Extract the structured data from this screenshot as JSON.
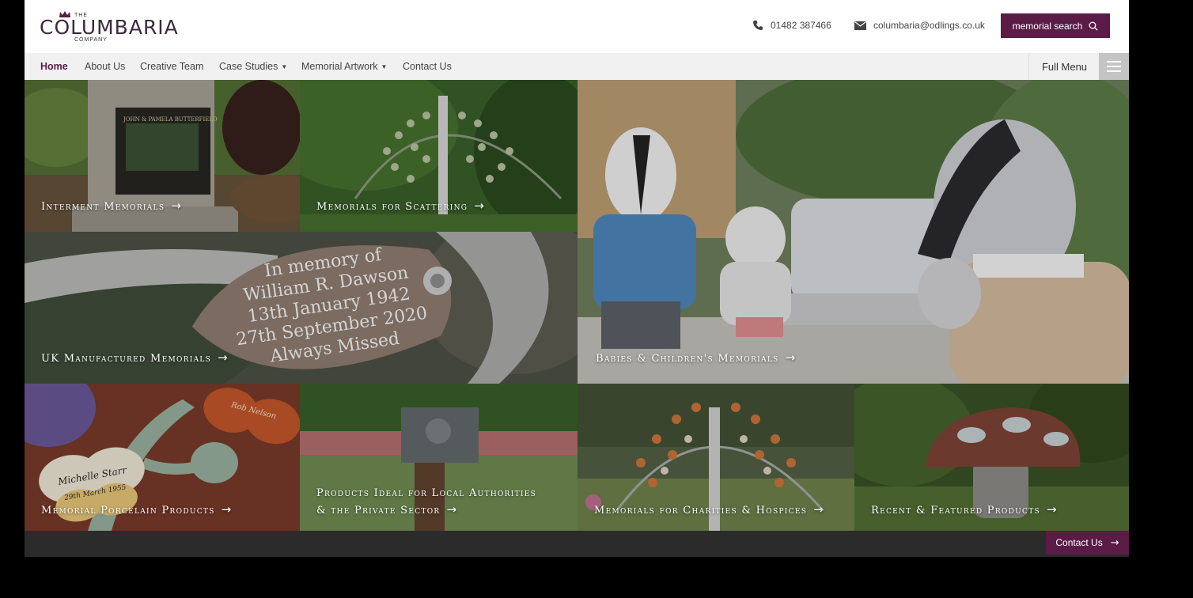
{
  "brand": {
    "the": "THE",
    "name": "COLUMBARIA",
    "company": "COMPANY",
    "accent": "#5a1b47"
  },
  "header": {
    "phone": "01482 387466",
    "email": "columbaria@odlings.co.uk",
    "search_label": "memorial search",
    "phone_icon": "phone-icon",
    "email_icon": "envelope-icon",
    "search_icon": "magnifier-icon"
  },
  "nav": {
    "items": [
      {
        "label": "Home"
      },
      {
        "label": "About Us"
      },
      {
        "label": "Creative Team"
      },
      {
        "label": "Case Studies",
        "caret": "▼"
      },
      {
        "label": "Memorial Artwork",
        "caret": "▼"
      },
      {
        "label": "Contact Us"
      }
    ],
    "full_menu": "Full Menu"
  },
  "tiles": {
    "interment": {
      "label": "Interment Memorials"
    },
    "scattering": {
      "label": "Memorials for Scattering"
    },
    "uk": {
      "label": "UK Manufactured Memorials"
    },
    "babies": {
      "label": "Babies & Children's Memorials"
    },
    "porcelain": {
      "label": "Memorial Porcelain Products"
    },
    "authorities": {
      "line1": "Products Ideal for Local Authorities",
      "line2": "& the Private Sector"
    },
    "charities": {
      "label": "Memorials for Charities & Hospices"
    },
    "recent": {
      "label": "Recent & Featured Products"
    }
  },
  "photo_text": {
    "plaque": {
      "line1": "In memory of",
      "line2": "William R. Dawson",
      "line3": "13th January 1942",
      "line4": "27th September 2020",
      "line5": "Always Missed"
    },
    "headstone_names": "JOHN & PAMELA BUTTERFIELD",
    "butterfly_name": "Michelle Starr",
    "butterfly_date": "29th March 1955",
    "butterfly_name2": "Rob Nelson"
  },
  "footer": {
    "contact_label": "Contact Us"
  }
}
